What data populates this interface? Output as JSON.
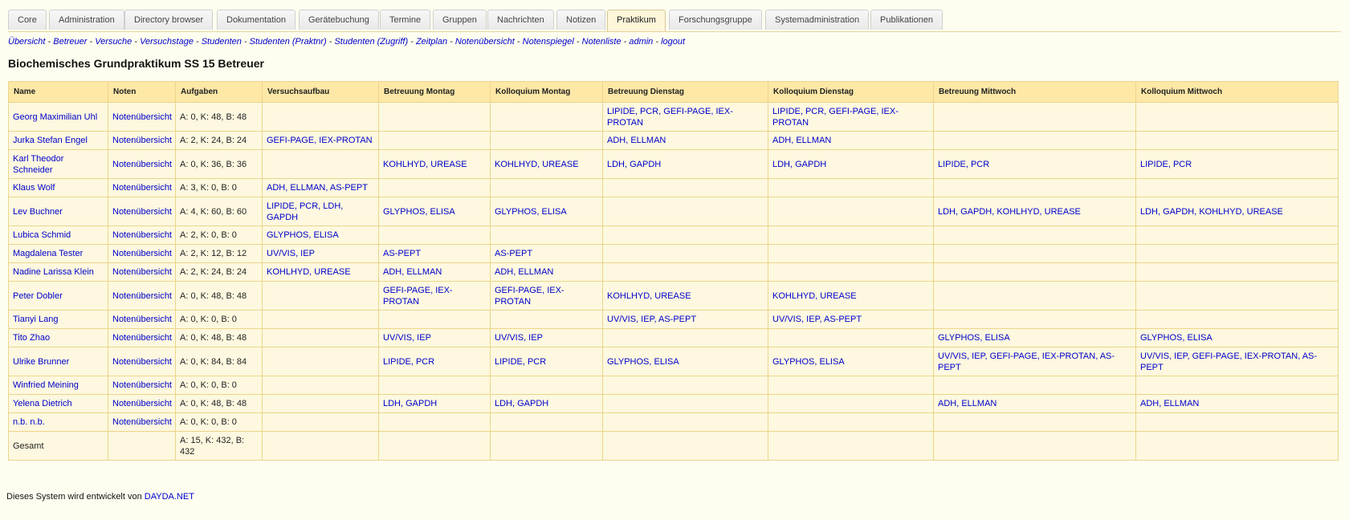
{
  "tabs": [
    {
      "label": "Core",
      "active": false
    },
    {
      "label": "Administration",
      "active": false
    },
    {
      "label": "Directory browser",
      "active": false
    },
    {
      "label": "Dokumentation",
      "active": false
    },
    {
      "label": "Gerätebuchung",
      "active": false
    },
    {
      "label": "Termine",
      "active": false
    },
    {
      "label": "Gruppen",
      "active": false
    },
    {
      "label": "Nachrichten",
      "active": false
    },
    {
      "label": "Notizen",
      "active": false
    },
    {
      "label": "Praktikum",
      "active": true
    },
    {
      "label": "Forschungsgruppe",
      "active": false
    },
    {
      "label": "Systemadministration",
      "active": false
    },
    {
      "label": "Publikationen",
      "active": false
    }
  ],
  "subnav": {
    "separator": " - ",
    "links": [
      "Übersicht",
      "Betreuer",
      "Versuche",
      "Versuchstage",
      "Studenten",
      "Studenten (Praktnr)",
      "Studenten (Zugriff)",
      "Zeitplan",
      "Notenübersicht",
      "Notenspiegel",
      "Notenliste",
      "admin",
      "logout"
    ]
  },
  "page_title": "Biochemisches Grundpraktikum SS 15 Betreuer",
  "table": {
    "headers": [
      "Name",
      "Noten",
      "Aufgaben",
      "Versuchsaufbau",
      "Betreuung Montag",
      "Kolloquium Montag",
      "Betreuung Dienstag",
      "Kolloquium Dienstag",
      "Betreuung Mittwoch",
      "Kolloquium Mittwoch"
    ],
    "rows": [
      {
        "name": "Georg Maximilian Uhl",
        "noten": "Notenübersicht",
        "aufgaben": "A: 0, K: 48, B: 48",
        "versuchsaufbau": "",
        "betreuung_montag": "",
        "kolloquium_montag": "",
        "betreuung_dienstag": "LIPIDE, PCR, GEFI-PAGE, IEX-PROTAN",
        "kolloquium_dienstag": "LIPIDE, PCR, GEFI-PAGE, IEX-PROTAN",
        "betreuung_mittwoch": "",
        "kolloquium_mittwoch": ""
      },
      {
        "name": "Jurka Stefan Engel",
        "noten": "Notenübersicht",
        "aufgaben": "A: 2, K: 24, B: 24",
        "versuchsaufbau": "GEFI-PAGE, IEX-PROTAN",
        "betreuung_montag": "",
        "kolloquium_montag": "",
        "betreuung_dienstag": "ADH, ELLMAN",
        "kolloquium_dienstag": "ADH, ELLMAN",
        "betreuung_mittwoch": "",
        "kolloquium_mittwoch": ""
      },
      {
        "name": "Karl Theodor Schneider",
        "noten": "Notenübersicht",
        "aufgaben": "A: 0, K: 36, B: 36",
        "versuchsaufbau": "",
        "betreuung_montag": "KOHLHYD, UREASE",
        "kolloquium_montag": "KOHLHYD, UREASE",
        "betreuung_dienstag": "LDH, GAPDH",
        "kolloquium_dienstag": "LDH, GAPDH",
        "betreuung_mittwoch": "LIPIDE, PCR",
        "kolloquium_mittwoch": "LIPIDE, PCR"
      },
      {
        "name": "Klaus Wolf",
        "noten": "Notenübersicht",
        "aufgaben": "A: 3, K: 0, B: 0",
        "versuchsaufbau": "ADH, ELLMAN, AS-PEPT",
        "betreuung_montag": "",
        "kolloquium_montag": "",
        "betreuung_dienstag": "",
        "kolloquium_dienstag": "",
        "betreuung_mittwoch": "",
        "kolloquium_mittwoch": ""
      },
      {
        "name": "Lev Buchner",
        "noten": "Notenübersicht",
        "aufgaben": "A: 4, K: 60, B: 60",
        "versuchsaufbau": "LIPIDE, PCR, LDH, GAPDH",
        "betreuung_montag": "GLYPHOS, ELISA",
        "kolloquium_montag": "GLYPHOS, ELISA",
        "betreuung_dienstag": "",
        "kolloquium_dienstag": "",
        "betreuung_mittwoch": "LDH, GAPDH, KOHLHYD, UREASE",
        "kolloquium_mittwoch": "LDH, GAPDH, KOHLHYD, UREASE"
      },
      {
        "name": "Lubica Schmid",
        "noten": "Notenübersicht",
        "aufgaben": "A: 2, K: 0, B: 0",
        "versuchsaufbau": "GLYPHOS, ELISA",
        "betreuung_montag": "",
        "kolloquium_montag": "",
        "betreuung_dienstag": "",
        "kolloquium_dienstag": "",
        "betreuung_mittwoch": "",
        "kolloquium_mittwoch": ""
      },
      {
        "name": "Magdalena Tester",
        "noten": "Notenübersicht",
        "aufgaben": "A: 2, K: 12, B: 12",
        "versuchsaufbau": "UV/VIS, IEP",
        "betreuung_montag": "AS-PEPT",
        "kolloquium_montag": "AS-PEPT",
        "betreuung_dienstag": "",
        "kolloquium_dienstag": "",
        "betreuung_mittwoch": "",
        "kolloquium_mittwoch": ""
      },
      {
        "name": "Nadine Larissa Klein",
        "noten": "Notenübersicht",
        "aufgaben": "A: 2, K: 24, B: 24",
        "versuchsaufbau": "KOHLHYD, UREASE",
        "betreuung_montag": "ADH, ELLMAN",
        "kolloquium_montag": "ADH, ELLMAN",
        "betreuung_dienstag": "",
        "kolloquium_dienstag": "",
        "betreuung_mittwoch": "",
        "kolloquium_mittwoch": ""
      },
      {
        "name": "Peter Dobler",
        "noten": "Notenübersicht",
        "aufgaben": "A: 0, K: 48, B: 48",
        "versuchsaufbau": "",
        "betreuung_montag": "GEFI-PAGE, IEX-PROTAN",
        "kolloquium_montag": "GEFI-PAGE, IEX-PROTAN",
        "betreuung_dienstag": "KOHLHYD, UREASE",
        "kolloquium_dienstag": "KOHLHYD, UREASE",
        "betreuung_mittwoch": "",
        "kolloquium_mittwoch": ""
      },
      {
        "name": "Tianyi Lang",
        "noten": "Notenübersicht",
        "aufgaben": "A: 0, K: 0, B: 0",
        "versuchsaufbau": "",
        "betreuung_montag": "",
        "kolloquium_montag": "",
        "betreuung_dienstag": "UV/VIS, IEP, AS-PEPT",
        "kolloquium_dienstag": "UV/VIS, IEP, AS-PEPT",
        "betreuung_mittwoch": "",
        "kolloquium_mittwoch": ""
      },
      {
        "name": "Tito Zhao",
        "noten": "Notenübersicht",
        "aufgaben": "A: 0, K: 48, B: 48",
        "versuchsaufbau": "",
        "betreuung_montag": "UV/VIS, IEP",
        "kolloquium_montag": "UV/VIS, IEP",
        "betreuung_dienstag": "",
        "kolloquium_dienstag": "",
        "betreuung_mittwoch": "GLYPHOS, ELISA",
        "kolloquium_mittwoch": "GLYPHOS, ELISA"
      },
      {
        "name": "Ulrike Brunner",
        "noten": "Notenübersicht",
        "aufgaben": "A: 0, K: 84, B: 84",
        "versuchsaufbau": "",
        "betreuung_montag": "LIPIDE, PCR",
        "kolloquium_montag": "LIPIDE, PCR",
        "betreuung_dienstag": "GLYPHOS, ELISA",
        "kolloquium_dienstag": "GLYPHOS, ELISA",
        "betreuung_mittwoch": "UV/VIS, IEP, GEFI-PAGE, IEX-PROTAN, AS-PEPT",
        "kolloquium_mittwoch": "UV/VIS, IEP, GEFI-PAGE, IEX-PROTAN, AS-PEPT"
      },
      {
        "name": "Winfried Meining",
        "noten": "Notenübersicht",
        "aufgaben": "A: 0, K: 0, B: 0",
        "versuchsaufbau": "",
        "betreuung_montag": "",
        "kolloquium_montag": "",
        "betreuung_dienstag": "",
        "kolloquium_dienstag": "",
        "betreuung_mittwoch": "",
        "kolloquium_mittwoch": ""
      },
      {
        "name": "Yelena Dietrich",
        "noten": "Notenübersicht",
        "aufgaben": "A: 0, K: 48, B: 48",
        "versuchsaufbau": "",
        "betreuung_montag": "LDH, GAPDH",
        "kolloquium_montag": "LDH, GAPDH",
        "betreuung_dienstag": "",
        "kolloquium_dienstag": "",
        "betreuung_mittwoch": "ADH, ELLMAN",
        "kolloquium_mittwoch": "ADH, ELLMAN"
      },
      {
        "name": "n.b. n.b.",
        "noten": "Notenübersicht",
        "aufgaben": "A: 0, K: 0, B: 0",
        "versuchsaufbau": "",
        "betreuung_montag": "",
        "kolloquium_montag": "",
        "betreuung_dienstag": "",
        "kolloquium_dienstag": "",
        "betreuung_mittwoch": "",
        "kolloquium_mittwoch": ""
      }
    ],
    "total": {
      "label": "Gesamt",
      "aufgaben": "A: 15, K: 432, B: 432"
    }
  },
  "footer": {
    "text": "Dieses System wird entwickelt von ",
    "link": "DAYDA.NET"
  },
  "colors": {
    "link": "#0000cc",
    "header_bg": "#fde8a6",
    "cell_bg": "#fdf8df",
    "page_bg": "#fefef0",
    "border": "#ecd48a"
  }
}
